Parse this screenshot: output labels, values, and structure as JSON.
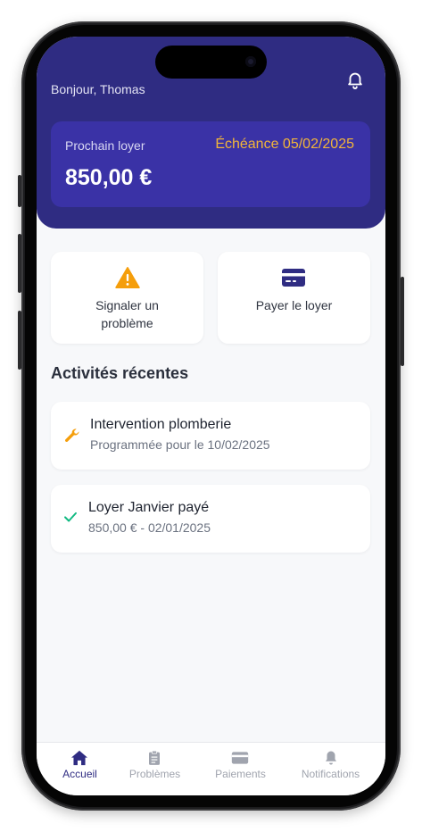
{
  "header": {
    "greeting": "Bonjour, Thomas",
    "rent_card": {
      "label": "Prochain loyer",
      "due": "Échéance 05/02/2025",
      "amount": "850,00 €"
    }
  },
  "actions": [
    {
      "label": "Signaler un problème",
      "icon": "warning-icon"
    },
    {
      "label": "Payer le loyer",
      "icon": "credit-card-icon"
    }
  ],
  "recent": {
    "title": "Activités récentes",
    "items": [
      {
        "title": "Intervention plomberie",
        "subtitle": "Programmée pour le 10/02/2025",
        "icon": "wrench-icon"
      },
      {
        "title": "Loyer Janvier payé",
        "subtitle": "850,00 € - 02/01/2025",
        "icon": "check-icon"
      }
    ]
  },
  "tabs": [
    {
      "label": "Accueil",
      "icon": "home-icon",
      "active": true
    },
    {
      "label": "Problèmes",
      "icon": "clipboard-icon",
      "active": false
    },
    {
      "label": "Paiements",
      "icon": "credit-card-icon",
      "active": false
    },
    {
      "label": "Notifications",
      "icon": "bell-icon",
      "active": false
    }
  ],
  "colors": {
    "primary": "#2f2c82",
    "card": "#3a32a6",
    "accent": "#f2b53a",
    "warning": "#f59e0b",
    "success": "#10b981"
  }
}
